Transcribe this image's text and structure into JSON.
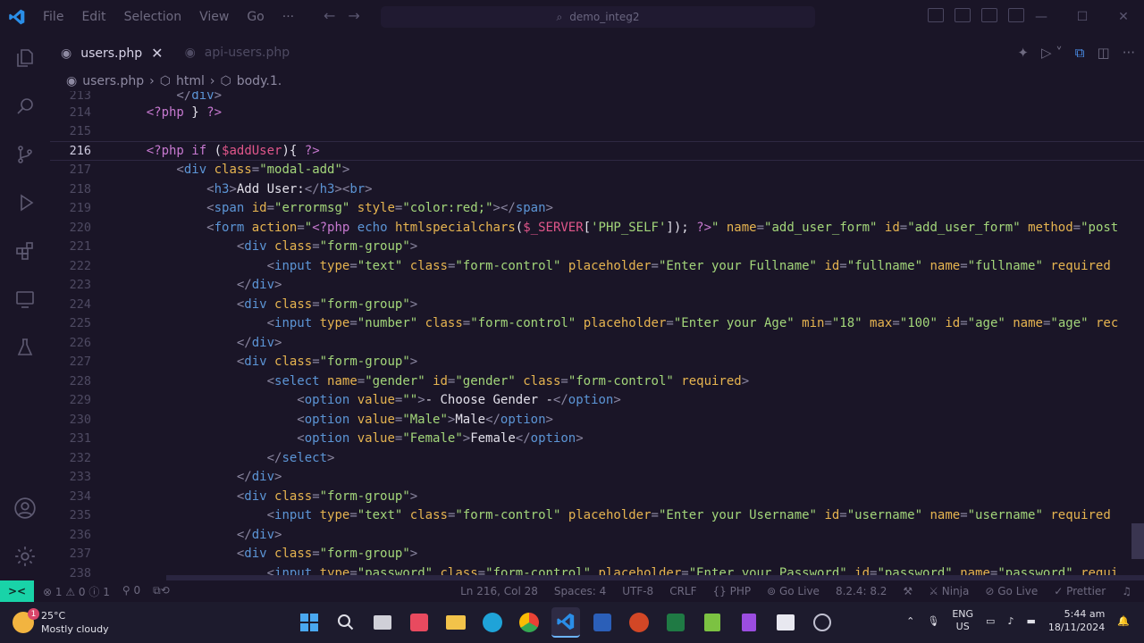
{
  "menu": [
    "File",
    "Edit",
    "Selection",
    "View",
    "Go",
    "···"
  ],
  "command_center": "demo_integ2",
  "tabs": [
    {
      "label": "users.php",
      "close": "✕"
    },
    {
      "label": "api-users.php"
    }
  ],
  "breadcrumb": {
    "file": "users.php",
    "html": "html",
    "body": "body.1."
  },
  "editor": {
    "current_line": 216,
    "cursor": "Ln 216, Col 28"
  },
  "status": {
    "errors": "1",
    "warnings": "0",
    "infos": "1",
    "ports": "0",
    "position": "Ln 216, Col 28",
    "spaces": "Spaces: 4",
    "encoding": "UTF-8",
    "eol": "CRLF",
    "language": "PHP",
    "golive1": "Go Live",
    "php_version": "8.2.4: 8.2",
    "ninja": "Ninja",
    "golive2": "Go Live",
    "prettier": "Prettier"
  },
  "weather": {
    "temp": "25°C",
    "desc": "Mostly cloudy",
    "badge": "1"
  },
  "tray": {
    "lang1": "ENG",
    "lang2": "US",
    "time": "5:44 am",
    "date": "18/11/2024"
  },
  "colors": {
    "accent": "#19d3a8",
    "bg": "#1a1527",
    "tag": "#5c95d6",
    "attr": "#e6b450",
    "string": "#a3d67a"
  }
}
